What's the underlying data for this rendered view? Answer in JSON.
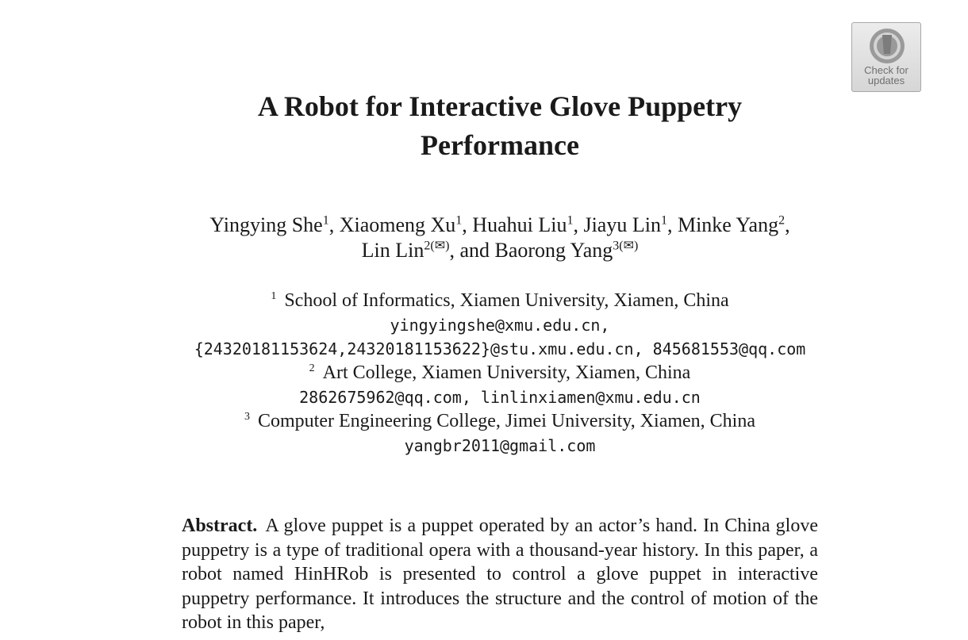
{
  "badge": {
    "icon": "crossmark-icon",
    "text": "Check for\nupdates"
  },
  "paper": {
    "title_line1": "A Robot for Interactive Glove Puppetry",
    "title_line2": "Performance",
    "authors": [
      {
        "name": "Yingying She",
        "sup": "1",
        "sep": ", "
      },
      {
        "name": "Xiaomeng Xu",
        "sup": "1",
        "sep": ", "
      },
      {
        "name": "Huahui Liu",
        "sup": "1",
        "sep": ", "
      },
      {
        "name": "Jiayu Lin",
        "sup": "1",
        "sep": ", "
      },
      {
        "name": "Minke Yang",
        "sup": "2",
        "sep": ","
      },
      {
        "name": "Lin Lin",
        "sup": "2(✉)",
        "sep": ", and "
      },
      {
        "name": "Baorong Yang",
        "sup": "3(✉)",
        "sep": ""
      }
    ],
    "affiliations": [
      {
        "num": "1",
        "name": "School of Informatics, Xiamen University, Xiamen, China",
        "emails": [
          "yingyingshe@xmu.edu.cn,",
          "{24320181153624,24320181153622}@stu.xmu.edu.cn, 845681553@qq.com"
        ]
      },
      {
        "num": "2",
        "name": "Art College, Xiamen University, Xiamen, China",
        "emails": [
          "2862675962@qq.com, linlinxiamen@xmu.edu.cn"
        ]
      },
      {
        "num": "3",
        "name": "Computer Engineering College, Jimei University, Xiamen, China",
        "emails": [
          "yangbr2011@gmail.com"
        ]
      }
    ],
    "abstract_label": "Abstract.",
    "abstract_text": "A glove puppet is a puppet operated by an actor’s hand. In China glove puppetry is a type of traditional opera with a thousand-year history. In this paper, a robot named HinHRob is presented to control a glove puppet in interactive puppetry performance. It introduces the structure and the control of motion of the robot in this paper,"
  }
}
